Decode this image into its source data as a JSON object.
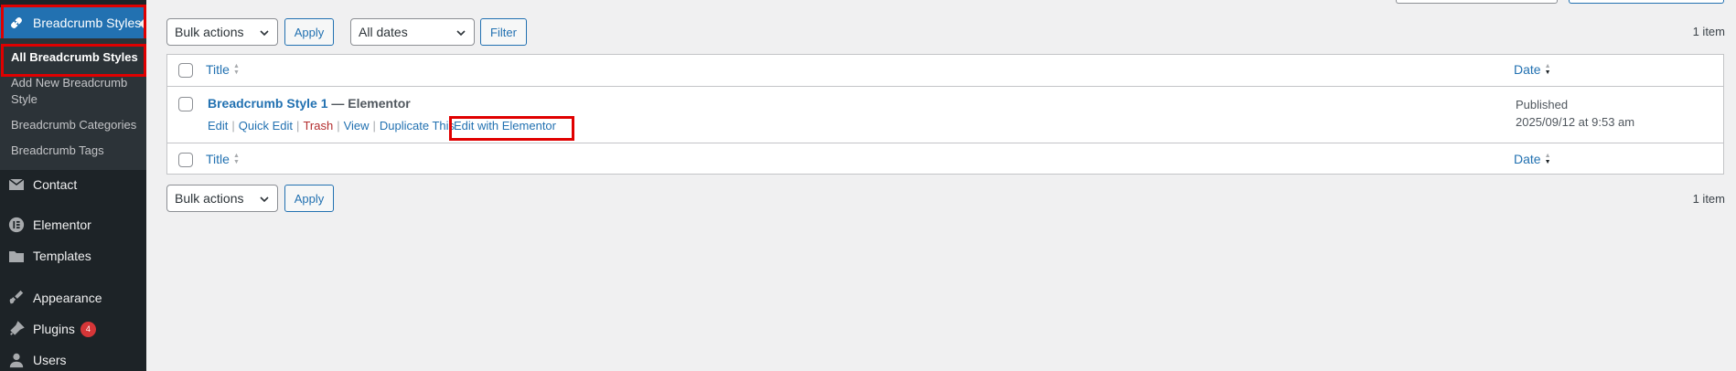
{
  "sidebar": {
    "current_menu": {
      "label": "Breadcrumb Styles",
      "icon": "link-icon"
    },
    "submenu": [
      {
        "label": "All Breadcrumb Styles",
        "current": true
      },
      {
        "label": "Add New Breadcrumb Style"
      },
      {
        "label": "Breadcrumb Categories"
      },
      {
        "label": "Breadcrumb Tags"
      }
    ],
    "menu": [
      {
        "label": "Contact",
        "icon": "mail-icon"
      },
      {
        "label": "Elementor",
        "icon": "elementor-icon"
      },
      {
        "label": "Templates",
        "icon": "folder-icon"
      },
      {
        "label": "Appearance",
        "icon": "paintbrush-icon"
      },
      {
        "label": "Plugins",
        "icon": "plugin-icon",
        "badge": "4"
      },
      {
        "label": "Users",
        "icon": "user-icon"
      }
    ]
  },
  "toolbar_top": {
    "bulk_actions": "Bulk actions",
    "apply": "Apply",
    "dates": "All dates",
    "filter": "Filter",
    "count": "1 item"
  },
  "table": {
    "col_title": "Title",
    "col_date": "Date",
    "rows": [
      {
        "title": "Breadcrumb Style 1",
        "state": "— Elementor",
        "actions": [
          "Edit",
          "Quick Edit",
          "Trash",
          "View",
          "Duplicate This",
          "Edit with Elementor"
        ],
        "status": "Published",
        "date": "2025/09/12 at 9:53 am"
      }
    ]
  },
  "toolbar_bottom": {
    "bulk_actions": "Bulk actions",
    "apply": "Apply",
    "count": "1 item"
  },
  "colors": {
    "accent": "#2271b1",
    "sidebar_bg": "#1d2327",
    "highlight": "#e00000",
    "trash": "#b32d2e"
  }
}
